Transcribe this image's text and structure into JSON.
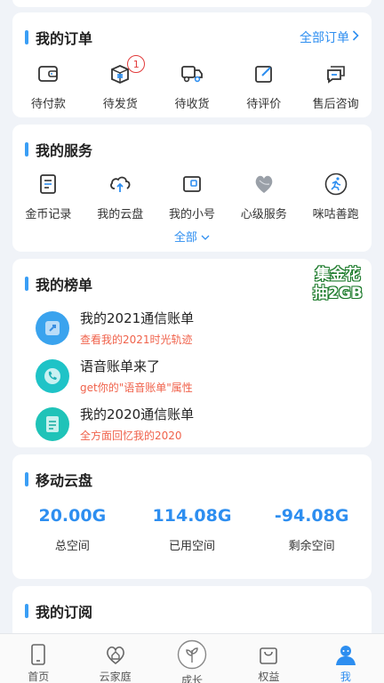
{
  "orders": {
    "title": "我的订单",
    "all_link": "全部订单",
    "items": [
      {
        "label": "待付款",
        "icon": "wallet-icon"
      },
      {
        "label": "待发货",
        "icon": "package-icon",
        "badge": "1"
      },
      {
        "label": "待收货",
        "icon": "truck-icon"
      },
      {
        "label": "待评价",
        "icon": "edit-icon"
      },
      {
        "label": "售后咨询",
        "icon": "chat-icon"
      }
    ]
  },
  "services": {
    "title": "我的服务",
    "all_toggle": "全部",
    "items": [
      {
        "label": "金币记录",
        "icon": "coin-record-icon"
      },
      {
        "label": "我的云盘",
        "icon": "cloud-upload-icon"
      },
      {
        "label": "我的小号",
        "icon": "sim-card-icon"
      },
      {
        "label": "心级服务",
        "icon": "heart-service-icon"
      },
      {
        "label": "咪咕善跑",
        "icon": "runner-icon"
      }
    ]
  },
  "rankings": {
    "title": "我的榜单",
    "promo_line1": "集金花",
    "promo_line2": "抽2GB",
    "items": [
      {
        "title": "我的2021通信账单",
        "subtitle": "查看我的2021时光轨迹",
        "icon": "rocket-icon",
        "color": "#3aa3ee"
      },
      {
        "title": "语音账单来了",
        "subtitle": "get你的\"语音账单\"属性",
        "icon": "phone-icon",
        "color": "#1fc3c7"
      },
      {
        "title": "我的2020通信账单",
        "subtitle": "全方面回忆我的2020",
        "icon": "document-icon",
        "color": "#1fc3b8"
      }
    ]
  },
  "cloud": {
    "title": "移动云盘",
    "stats": [
      {
        "value": "20.00G",
        "label": "总空间"
      },
      {
        "value": "114.08G",
        "label": "已用空间"
      },
      {
        "value": "-94.08G",
        "label": "剩余空间"
      }
    ]
  },
  "subscriptions": {
    "title": "我的订阅"
  },
  "tabbar": {
    "tabs": [
      {
        "label": "首页",
        "icon": "phone-home-icon"
      },
      {
        "label": "云家庭",
        "icon": "family-icon"
      },
      {
        "label": "成长",
        "icon": "growth-icon"
      },
      {
        "label": "权益",
        "icon": "bag-icon"
      },
      {
        "label": "我",
        "icon": "user-icon",
        "active": true
      }
    ]
  },
  "colors": {
    "accent": "#2d8ef0",
    "badge": "#e23b3b",
    "subtitle": "#f0624b",
    "background": "#f0f3f8"
  }
}
